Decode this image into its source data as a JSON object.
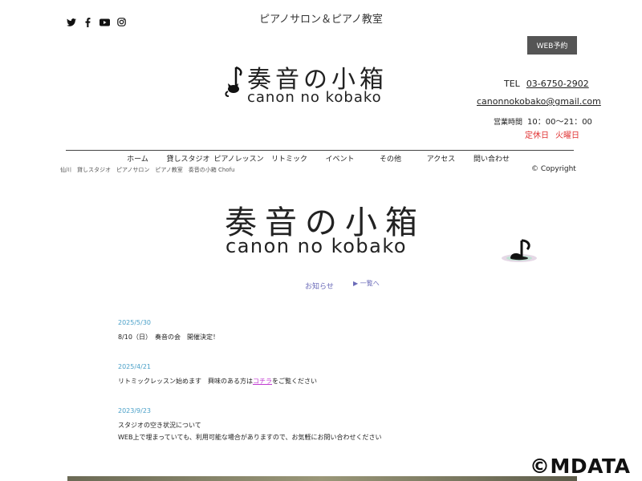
{
  "header": {
    "tagline": "ピアノサロン＆ピアノ教室",
    "web_button": "WEB予約",
    "logo_kanji": "奏音の小箱",
    "logo_romaji": "canon no kobako",
    "tel_label": "TEL",
    "tel_number": "03-6750-2902",
    "email": "canonnokobako@gmail.com",
    "hours_label": "営業時間",
    "hours_value": "10：00〜21：00",
    "closed_label": "定休日",
    "closed_day": "火曜日"
  },
  "social": {
    "icons": [
      "twitter-icon",
      "facebook-icon",
      "youtube-icon",
      "instagram-icon"
    ]
  },
  "nav": {
    "items": [
      "ホーム",
      "貸しスタジオ",
      "ピアノレッスン",
      "リトミック",
      "イベント",
      "その他",
      "アクセス",
      "問い合わせ"
    ]
  },
  "breadcrumb": "仙川　貸しスタジオ　ピアノサロン　ピアノ教室　奏音の小箱 Chofu",
  "copyright": "© Copyright",
  "main_logo": {
    "kanji": "奏音の小箱",
    "romaji": "canon no kobako"
  },
  "news": {
    "label": "お知らせ",
    "all_link": "▶ 一覧へ",
    "posts": [
      {
        "date": "2025/5/30",
        "lines": [
          "8/10（日）　奏音の会　開催決定！"
        ]
      },
      {
        "date": "2025/4/21",
        "text_before": "リトミックレッスン始めます　興味のある方は",
        "link": "コチラ",
        "text_after": "をご覧ください"
      },
      {
        "date": "2023/9/23",
        "lines": [
          "スタジオの空き状況について",
          "WEB上で埋まっていても、利用可能な場合がありますので、お気軽にお問い合わせください"
        ]
      }
    ]
  },
  "watermark": "©MDATA",
  "colors": {
    "accent_link": "#6a6ab8",
    "date": "#4aa0c8",
    "closed": "#e03030",
    "button": "#555555"
  }
}
